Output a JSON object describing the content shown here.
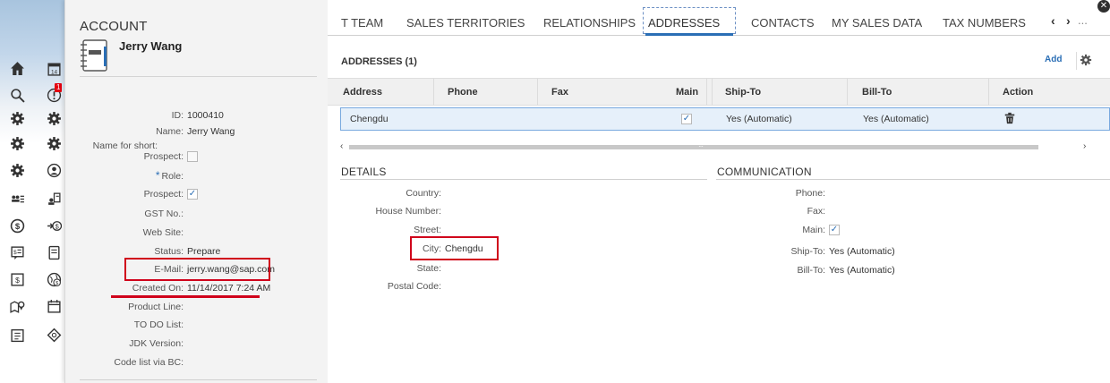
{
  "rail": {
    "badge": "1"
  },
  "account": {
    "title": "ACCOUNT",
    "name": "Jerry Wang",
    "fields": {
      "id": {
        "label": "ID:",
        "value": "1000410"
      },
      "name": {
        "label": "Name:",
        "value": "Jerry Wang"
      },
      "short": {
        "label": "Name for short:",
        "value": ""
      },
      "prospect1": {
        "label": "Prospect:",
        "checked": false
      },
      "role": {
        "label": "Role:",
        "value": "",
        "required": "*"
      },
      "prospect2": {
        "label": "Prospect:",
        "checked": true
      },
      "gst": {
        "label": "GST No.:",
        "value": ""
      },
      "web": {
        "label": "Web Site:",
        "value": ""
      },
      "status": {
        "label": "Status:",
        "value": "Prepare"
      },
      "email": {
        "label": "E-Mail:",
        "value": "jerry.wang@sap.com"
      },
      "created": {
        "label": "Created On:",
        "value": "11/14/2017 7:24 AM"
      },
      "product": {
        "label": "Product Line:",
        "value": ""
      },
      "todo": {
        "label": "TO DO List:",
        "value": ""
      },
      "jdk": {
        "label": "JDK Version:",
        "value": ""
      },
      "codelist": {
        "label": "Code list via BC:",
        "value": ""
      }
    }
  },
  "tabs": {
    "items": [
      "T TEAM",
      "SALES TERRITORIES",
      "RELATIONSHIPS",
      "ADDRESSES",
      "CONTACTS",
      "MY SALES DATA",
      "TAX NUMBERS"
    ],
    "active": "ADDRESSES",
    "prev": "‹",
    "next": "›",
    "more": "..."
  },
  "addresses": {
    "title": "ADDRESSES (1)",
    "add_label": "Add",
    "columns": [
      "Address",
      "Phone",
      "Fax",
      "Main",
      "Ship-To",
      "Bill-To",
      "Action"
    ],
    "rows": [
      {
        "address": "Chengdu",
        "phone": "",
        "fax": "",
        "main": true,
        "ship_to": "Yes (Automatic)",
        "bill_to": "Yes (Automatic)"
      }
    ]
  },
  "details": {
    "title": "DETAILS",
    "fields": {
      "country": {
        "label": "Country:",
        "value": ""
      },
      "house": {
        "label": "House Number:",
        "value": ""
      },
      "street": {
        "label": "Street:",
        "value": ""
      },
      "city": {
        "label": "City:",
        "value": "Chengdu"
      },
      "state": {
        "label": "State:",
        "value": ""
      },
      "postal": {
        "label": "Postal Code:",
        "value": ""
      }
    }
  },
  "communication": {
    "title": "COMMUNICATION",
    "fields": {
      "phone": {
        "label": "Phone:",
        "value": ""
      },
      "fax": {
        "label": "Fax:",
        "value": ""
      },
      "main": {
        "label": "Main:",
        "checked": true
      },
      "ship_to": {
        "label": "Ship-To:",
        "value": "Yes (Automatic)"
      },
      "bill_to": {
        "label": "Bill-To:",
        "value": "Yes (Automatic)"
      }
    }
  },
  "colors": {
    "accent": "#2a6eb5",
    "highlight": "#d0021b",
    "selected_row": "#e6f0fa",
    "grid_header": "#f0f0f0"
  }
}
